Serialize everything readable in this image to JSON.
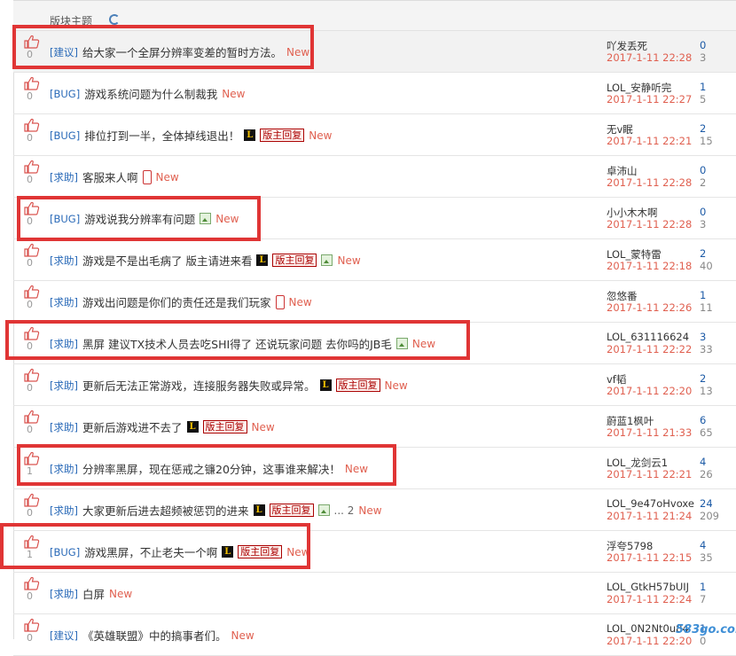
{
  "header": {
    "label": "版块主题"
  },
  "colors": {
    "tag": "#2a6ab8",
    "new": "#e06050",
    "date": "#e06050",
    "replies": "#1c5aa6",
    "highlight_box": "#e03535"
  },
  "new_label": "New",
  "mod_label": "版主回复",
  "lol_badge": "L",
  "threads": [
    {
      "likes": "0",
      "tag": "[建议]",
      "title": "给大家一个全屏分辨率变差的暂时方法。",
      "extras": [],
      "author": "吖发丢死",
      "date": "2017-1-11 22:28",
      "replies": "0",
      "views": "3",
      "highlight": true
    },
    {
      "likes": "0",
      "tag": "[BUG]",
      "title": "游戏系统问题为什么制裁我",
      "extras": [],
      "author": "LOL_安静听完",
      "date": "2017-1-11 22:27",
      "replies": "1",
      "views": "5",
      "highlight": false
    },
    {
      "likes": "0",
      "tag": "[BUG]",
      "title": "排位打到一半，全体掉线退出！",
      "extras": [
        "lol",
        "mod"
      ],
      "author": "无v眠",
      "date": "2017-1-11 22:21",
      "replies": "2",
      "views": "15",
      "highlight": false
    },
    {
      "likes": "0",
      "tag": "[求助]",
      "title": "客服来人啊",
      "extras": [
        "phone"
      ],
      "author": "卓沛山",
      "date": "2017-1-11 22:28",
      "replies": "0",
      "views": "2",
      "highlight": false
    },
    {
      "likes": "0",
      "tag": "[BUG]",
      "title": "游戏说我分辨率有问题",
      "extras": [
        "img"
      ],
      "author": "小小木木啊",
      "date": "2017-1-11 22:28",
      "replies": "0",
      "views": "3",
      "highlight": false
    },
    {
      "likes": "0",
      "tag": "[求助]",
      "title": "游戏是不是出毛病了 版主请进来看",
      "extras": [
        "lol",
        "mod",
        "img"
      ],
      "author": "LOL_蒙特雷",
      "date": "2017-1-11 22:18",
      "replies": "2",
      "views": "40",
      "highlight": false
    },
    {
      "likes": "0",
      "tag": "[求助]",
      "title": "游戏出问题是你们的责任还是我们玩家",
      "extras": [
        "phone"
      ],
      "author": "忽悠番",
      "date": "2017-1-11 22:26",
      "replies": "1",
      "views": "11",
      "highlight": false
    },
    {
      "likes": "0",
      "tag": "[求助]",
      "title": "黑屏 建议TX技术人员去吃SHI得了 还说玩家问题 去你吗的JB毛",
      "extras": [
        "img"
      ],
      "author": "LOL_631116624",
      "date": "2017-1-11 22:22",
      "replies": "3",
      "views": "33",
      "highlight": false
    },
    {
      "likes": "0",
      "tag": "[求助]",
      "title": "更新后无法正常游戏，连接服务器失败或异常。",
      "extras": [
        "lol",
        "mod"
      ],
      "author": "vf韬",
      "date": "2017-1-11 22:20",
      "replies": "2",
      "views": "13",
      "highlight": false
    },
    {
      "likes": "0",
      "tag": "[求助]",
      "title": "更新后游戏进不去了",
      "extras": [
        "lol",
        "mod"
      ],
      "author": "蔚蓝1枫叶",
      "date": "2017-1-11 21:33",
      "replies": "6",
      "views": "65",
      "highlight": false
    },
    {
      "likes": "1",
      "tag": "[求助]",
      "title": "分辨率黑屏，现在惩戒之镰20分钟，这事谁来解决！",
      "extras": [],
      "author": "LOL_龙剑云1",
      "date": "2017-1-11 22:21",
      "replies": "4",
      "views": "26",
      "highlight": false
    },
    {
      "likes": "0",
      "tag": "[求助]",
      "title": "大家更新后进去超频被惩罚的进来",
      "extras": [
        "lol",
        "mod",
        "img",
        "more"
      ],
      "more_text": "... 2",
      "author": "LOL_9e47oHvoxe",
      "date": "2017-1-11 21:24",
      "replies": "24",
      "views": "209",
      "highlight": false
    },
    {
      "likes": "1",
      "tag": "[BUG]",
      "title": "游戏黑屏，不止老夫一个啊",
      "extras": [
        "lol",
        "mod"
      ],
      "author": "浮夸5798",
      "date": "2017-1-11 22:15",
      "replies": "4",
      "views": "35",
      "highlight": false
    },
    {
      "likes": "0",
      "tag": "[求助]",
      "title": "白屏",
      "extras": [],
      "author": "LOL_GtkH57bUIJ",
      "date": "2017-1-11 22:24",
      "replies": "1",
      "views": "7",
      "highlight": false
    },
    {
      "likes": "0",
      "tag": "[建议]",
      "title": "《英雄联盟》中的搞事者们。",
      "extras": [],
      "author": "LOL_0N2Nt0u84",
      "date": "2017-1-11 22:20",
      "replies": "1",
      "views": "0",
      "highlight": false
    }
  ],
  "watermark": "583go.com"
}
